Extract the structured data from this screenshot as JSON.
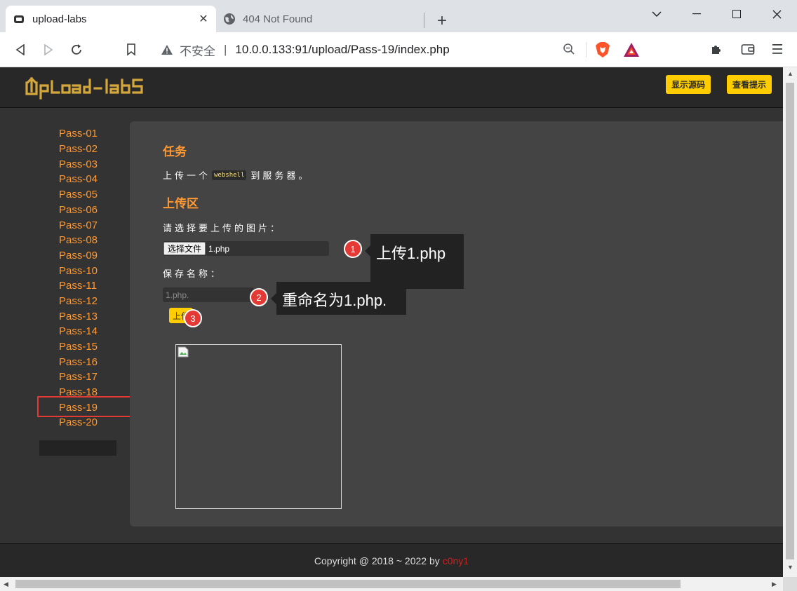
{
  "browser": {
    "tabs": [
      {
        "title": "upload-labs",
        "active": true,
        "favicon": "upload-labs-favicon-icon"
      },
      {
        "title": "404 Not Found",
        "active": false,
        "favicon": "globe-icon"
      }
    ],
    "address": {
      "security_label": "不安全",
      "url": "10.0.0.133:91/upload/Pass-19/index.php"
    }
  },
  "site": {
    "logo_text": "UpLoad-labS",
    "buttons": {
      "show_source": "显示源码",
      "show_hint": "查看提示"
    },
    "nav": [
      "Pass-01",
      "Pass-02",
      "Pass-03",
      "Pass-04",
      "Pass-05",
      "Pass-06",
      "Pass-07",
      "Pass-08",
      "Pass-09",
      "Pass-10",
      "Pass-11",
      "Pass-12",
      "Pass-13",
      "Pass-14",
      "Pass-15",
      "Pass-16",
      "Pass-17",
      "Pass-18",
      "Pass-19",
      "Pass-20"
    ],
    "active_nav": "Pass-19",
    "task": {
      "heading": "任务",
      "text_before": "上传一个",
      "code": "webshell",
      "text_after": "到服务器。"
    },
    "upload": {
      "heading": "上传区",
      "select_label": "请选择要上传的图片：",
      "file_button": "选择文件",
      "file_name": "1.php",
      "save_label": "保存名称：",
      "save_value": "1.php.",
      "submit": "上传"
    },
    "footer": {
      "copyright": "Copyright @ 2018 ~ 2022 by",
      "author": "c0ny1"
    }
  },
  "annotations": [
    {
      "number": "1",
      "text": "上传1.php"
    },
    {
      "number": "2",
      "text": "重命名为1.php."
    },
    {
      "number": "3",
      "text": ""
    }
  ],
  "colors": {
    "accent": "#ff9933",
    "button": "#ffcc00",
    "marker": "#e53935"
  }
}
